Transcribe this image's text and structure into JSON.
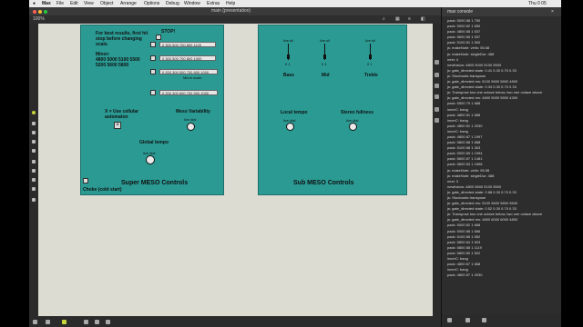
{
  "menubar": {
    "items": [
      "Max",
      "File",
      "Edit",
      "View",
      "Object",
      "Arrange",
      "Options",
      "Debug",
      "Window",
      "Extras",
      "Help"
    ],
    "clock": "Thu 0 05"
  },
  "window": {
    "title": "main (presentation)"
  },
  "toolbar": {
    "zoom": "100%"
  },
  "panel_left": {
    "note": [
      "For best results, first hit",
      "stop before changing",
      "scale."
    ],
    "stop_label": "STOP!",
    "minor_label": "Minor:",
    "minor_values": [
      "4800 5000 5100 5500",
      "5200 5600 5800"
    ],
    "messages": [
      "0 300 500 700 800 1100",
      "0 300 500 700 800 1000",
      "0 200 300 500 700 800 1000",
      "0 200 300 500 700 900 1000"
    ],
    "minor_scale_label": "Minor scale",
    "cellular_label": [
      "X = Use cellular",
      "automaton"
    ],
    "meso_variability_label": "Meso Variability",
    "meso_var_dial": "live.dial",
    "global_tempo_label": "Global tempo",
    "global_tempo_dial": "live.dial",
    "title": "Super MESO Controls",
    "choke_label": "Choke (cold start)"
  },
  "panel_right": {
    "sliders": [
      {
        "label": "Bass",
        "top": "live.sli",
        "value": "0 1"
      },
      {
        "label": "Mid",
        "top": "live.sli",
        "value": "0 1"
      },
      {
        "label": "Treble",
        "top": "live.sli",
        "value": "0 1"
      }
    ],
    "local_tempo_label": "Local tempo",
    "local_tempo_dial": "live.dial",
    "stereo_fullness_label": "Stereo fullness",
    "stereo_fullness_dial": "live.dial",
    "title": "Sub MESO Controls"
  },
  "console": {
    "title": "max console",
    "lines": [
      "pack: 5000 88 1 750",
      "pack: 5000 82 1 650",
      "pack: 4800 88 1 537",
      "pack: 5600 85 1 537",
      "pack: 5100 81 1 500",
      "js:  makeNote: velIn: 55.58",
      "js:  makeNote: singleDur: 488",
      "next: 4",
      "newfusion: 4800 5000 5100 5500",
      "js:  gate_directed state: 0.41 0.30 0.70 0.33",
      "js:  Stochastic transpose",
      "js:  gate_directed res: 5100 5600 5800 4800",
      "js:  gate_directed state: 0.34 0.30 0.70 0.33",
      "js:  Transpose two one octave below, two one octave above",
      "js:  gate_directed res: 4800 5000 5500 4300",
      "pack: 5500 79 1 688",
      "innerC: bang",
      "pack: 4800 81 1 688",
      "innerC: bang",
      "pack: 4800 81 1 2030",
      "innerC: bang",
      "pack: 4800 87 1 1997",
      "pack: 5800 88 1 688",
      "pack: 5100 88 1 303",
      "pack: 5000 89 1 1994",
      "pack: 5600 87 1 1481",
      "pack: 5600 83 1 1898",
      "js:  makeNote: velIn: 55.58",
      "js:  makeNote: singleDur: 488",
      "next: 3",
      "newfusion: 4800 5600 5100 5500",
      "js:  gate_directed state: 0.68 0.30 0.70 0.33",
      "js:  Stochastic transpose",
      "js:  gate_directed res: 5100 5600 5800 5600",
      "js:  gate_directed state: 0.52 0.30 0.70 0.33",
      "js:  Transpose two one octave below, two one octave above",
      "js:  gate_directed res: 4800 6000 6000 4800",
      "pack: 5000 82 1 668",
      "pack: 5000 88 1 666",
      "pack: 5100 85 1 552",
      "pack: 5800 84 1 503",
      "pack: 5800 88 1 1119",
      "pack: 5800 80 1 502",
      "innerC: bang",
      "pack: 4800 87 1 668",
      "innerC: bang",
      "pack: 4800 87 1 2030"
    ]
  },
  "colors": {
    "panel": "#2a9a93",
    "canvas": "#dcdcd3",
    "console_bg": "#2d2d2d"
  },
  "icons": [
    "lock-icon",
    "presentation-icon",
    "comment-icon",
    "grid-icon",
    "inspector-icon",
    "console-icon"
  ]
}
